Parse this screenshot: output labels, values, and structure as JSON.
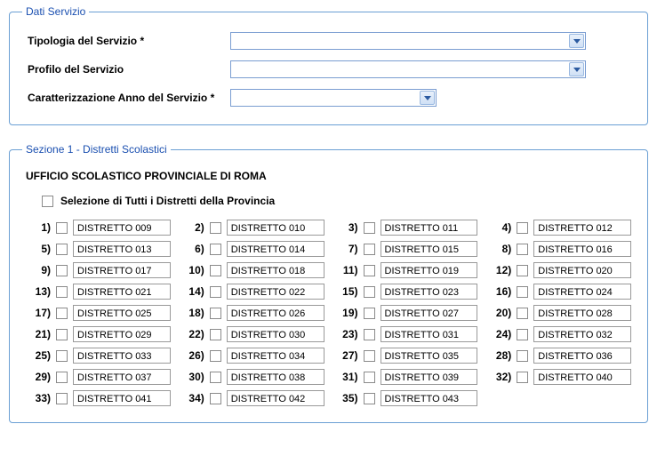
{
  "section1": {
    "legend": "Dati Servizio",
    "fields": {
      "tipologia_label": "Tipologia del Servizio *",
      "tipologia_value": "",
      "profilo_label": "Profilo del Servizio",
      "profilo_value": "",
      "anno_label": "Caratterizzazione Anno del Servizio *",
      "anno_value": ""
    }
  },
  "section2": {
    "legend": "Sezione 1 - Distretti Scolastici",
    "heading": "UFFICIO SCOLASTICO PROVINCIALE DI ROMA",
    "select_all_label": "Selezione di Tutti i Distretti della Provincia",
    "districts": [
      {
        "n": "1",
        "name": "DISTRETTO 009"
      },
      {
        "n": "2",
        "name": "DISTRETTO 010"
      },
      {
        "n": "3",
        "name": "DISTRETTO 011"
      },
      {
        "n": "4",
        "name": "DISTRETTO 012"
      },
      {
        "n": "5",
        "name": "DISTRETTO 013"
      },
      {
        "n": "6",
        "name": "DISTRETTO 014"
      },
      {
        "n": "7",
        "name": "DISTRETTO 015"
      },
      {
        "n": "8",
        "name": "DISTRETTO 016"
      },
      {
        "n": "9",
        "name": "DISTRETTO 017"
      },
      {
        "n": "10",
        "name": "DISTRETTO 018"
      },
      {
        "n": "11",
        "name": "DISTRETTO 019"
      },
      {
        "n": "12",
        "name": "DISTRETTO 020"
      },
      {
        "n": "13",
        "name": "DISTRETTO 021"
      },
      {
        "n": "14",
        "name": "DISTRETTO 022"
      },
      {
        "n": "15",
        "name": "DISTRETTO 023"
      },
      {
        "n": "16",
        "name": "DISTRETTO 024"
      },
      {
        "n": "17",
        "name": "DISTRETTO 025"
      },
      {
        "n": "18",
        "name": "DISTRETTO 026"
      },
      {
        "n": "19",
        "name": "DISTRETTO 027"
      },
      {
        "n": "20",
        "name": "DISTRETTO 028"
      },
      {
        "n": "21",
        "name": "DISTRETTO 029"
      },
      {
        "n": "22",
        "name": "DISTRETTO 030"
      },
      {
        "n": "23",
        "name": "DISTRETTO 031"
      },
      {
        "n": "24",
        "name": "DISTRETTO 032"
      },
      {
        "n": "25",
        "name": "DISTRETTO 033"
      },
      {
        "n": "26",
        "name": "DISTRETTO 034"
      },
      {
        "n": "27",
        "name": "DISTRETTO 035"
      },
      {
        "n": "28",
        "name": "DISTRETTO 036"
      },
      {
        "n": "29",
        "name": "DISTRETTO 037"
      },
      {
        "n": "30",
        "name": "DISTRETTO 038"
      },
      {
        "n": "31",
        "name": "DISTRETTO 039"
      },
      {
        "n": "32",
        "name": "DISTRETTO 040"
      },
      {
        "n": "33",
        "name": "DISTRETTO 041"
      },
      {
        "n": "34",
        "name": "DISTRETTO 042"
      },
      {
        "n": "35",
        "name": "DISTRETTO 043"
      }
    ]
  }
}
